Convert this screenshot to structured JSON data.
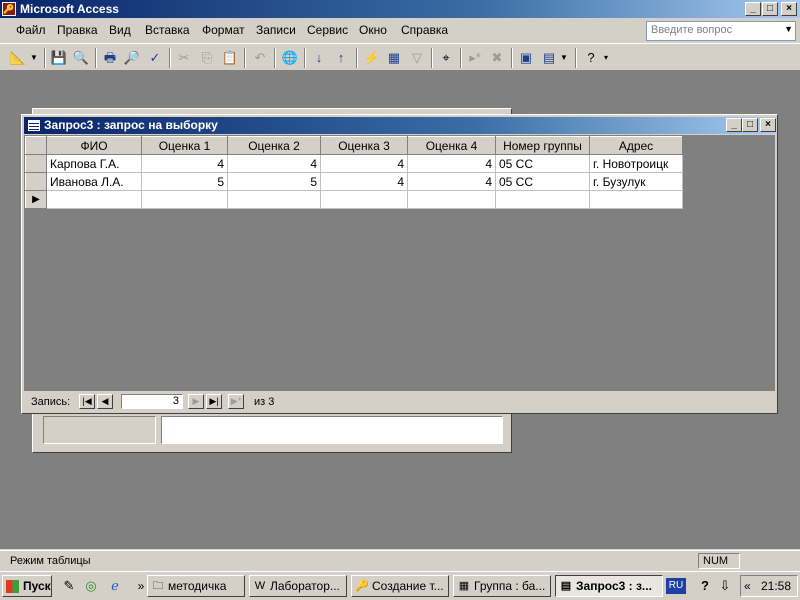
{
  "app": {
    "title": "Microsoft Access",
    "icon": "access-key-icon"
  },
  "window_controls": {
    "minimize": "_",
    "maximize": "□",
    "close": "×"
  },
  "menu": [
    "Файл",
    "Правка",
    "Вид",
    "Вставка",
    "Формат",
    "Записи",
    "Сервис",
    "Окно",
    "Справка"
  ],
  "help_box": {
    "placeholder": "Введите вопрос"
  },
  "query_window": {
    "title": "Запрос3 : запрос на выборку",
    "columns": [
      "ФИО",
      "Оценка 1",
      "Оценка 2",
      "Оценка 3",
      "Оценка 4",
      "Номер группы",
      "Адрес"
    ],
    "rows": [
      [
        "Карпова Г.А.",
        "4",
        "4",
        "4",
        "4",
        "05 СС",
        "г. Новотроицк"
      ],
      [
        "Иванова Л.А.",
        "5",
        "5",
        "4",
        "4",
        "05 СС",
        "г. Бузулук"
      ]
    ],
    "record_nav": {
      "label": "Запись:",
      "current": "3",
      "of_text": "из  3"
    }
  },
  "status": {
    "left": "Режим таблицы",
    "num": "NUM"
  },
  "taskbar": {
    "start": "Пуск",
    "buttons": [
      "методичка",
      "Лаборатор...",
      "Создание т...",
      "Группа : ба...",
      "Запрос3 : з..."
    ],
    "lang": "RU",
    "chevron": "«",
    "clock": "21:58"
  },
  "colors": {
    "titlebar": "#0a246a",
    "mdi_background": "#808080",
    "chrome": "#d4d0c8"
  }
}
